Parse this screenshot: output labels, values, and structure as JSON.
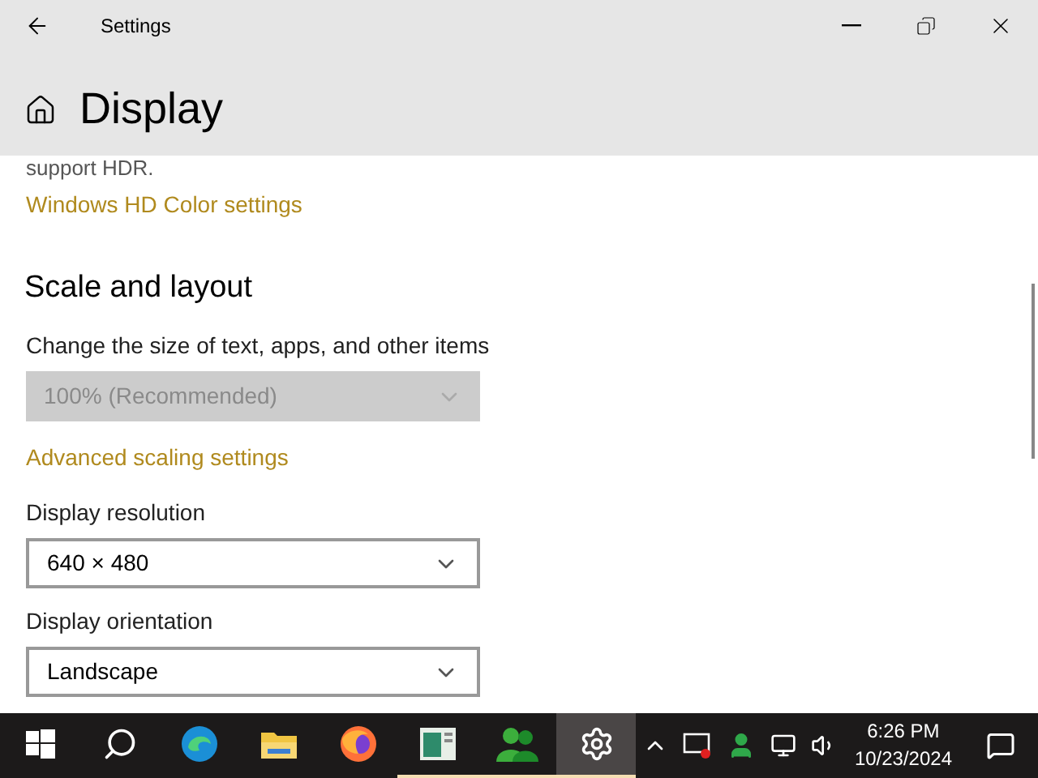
{
  "window": {
    "title": "Settings"
  },
  "page": {
    "title": "Display"
  },
  "hdr_note": "support HDR.",
  "hdr_link": "Windows HD Color settings",
  "section": {
    "title": "Scale and layout"
  },
  "settings": [
    {
      "label": "Change the size of text, apps, and other items",
      "value": "100% (Recommended)",
      "disabled": true,
      "link": "Advanced scaling settings"
    },
    {
      "label": "Display resolution",
      "value": "640 × 480",
      "disabled": false
    },
    {
      "label": "Display orientation",
      "value": "Landscape",
      "disabled": false
    }
  ],
  "taskbar": {
    "items": [
      {
        "kind": "start",
        "running": false,
        "selected": false
      },
      {
        "kind": "search",
        "running": false,
        "selected": false
      },
      {
        "kind": "edge",
        "running": false,
        "selected": false
      },
      {
        "kind": "folder",
        "running": false,
        "selected": false
      },
      {
        "kind": "firefox",
        "running": false,
        "selected": false
      },
      {
        "kind": "window",
        "running": true,
        "selected": false
      },
      {
        "kind": "people",
        "running": true,
        "selected": false
      },
      {
        "kind": "gear",
        "running": true,
        "selected": true
      }
    ],
    "time": "6:26 PM",
    "date": "10/23/2024"
  }
}
